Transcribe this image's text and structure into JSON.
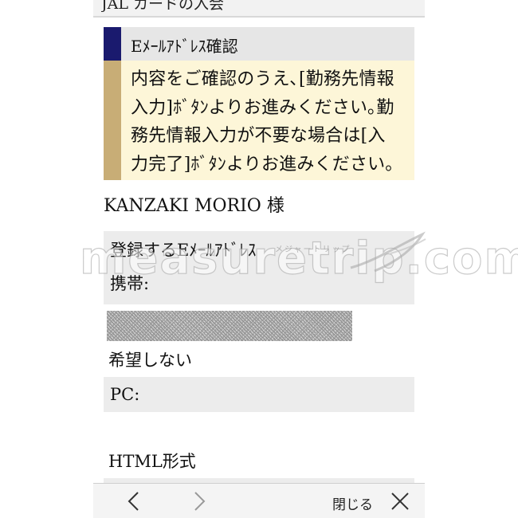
{
  "header": {
    "title": "JAL カードの入会"
  },
  "section": {
    "title": "Eﾒｰﾙｱﾄﾞﾚｽ確認"
  },
  "notice": {
    "lines": [
      "内容をご確認のうえ､[勤務先情報",
      "入力]ﾎﾞﾀﾝよりお進みください｡勤",
      "務先情報入力が不要な場合は[入",
      "力完了]ﾎﾞﾀﾝよりお進みください｡"
    ]
  },
  "customer": {
    "name": "KANZAKI MORIO 様"
  },
  "registration": {
    "label": "登録するEﾒｰﾙｱﾄﾞﾚｽ",
    "mobile_label": "携帯:",
    "preference": "希望しない",
    "pc_label": "PC:",
    "format_label": "HTML形式"
  },
  "watermark": {
    "text": "measuretrip.com",
    "kana": "メジャートリップ"
  },
  "toolbar": {
    "back_icon": "chevron-left-icon",
    "forward_icon": "chevron-right-icon",
    "close_label": "閉じる",
    "close_icon": "close-icon"
  },
  "colors": {
    "section_bar": "#1a1a6e",
    "notice_bar": "#c8ad76",
    "notice_bg": "#fdf6d8",
    "block_bg": "#ececec"
  }
}
